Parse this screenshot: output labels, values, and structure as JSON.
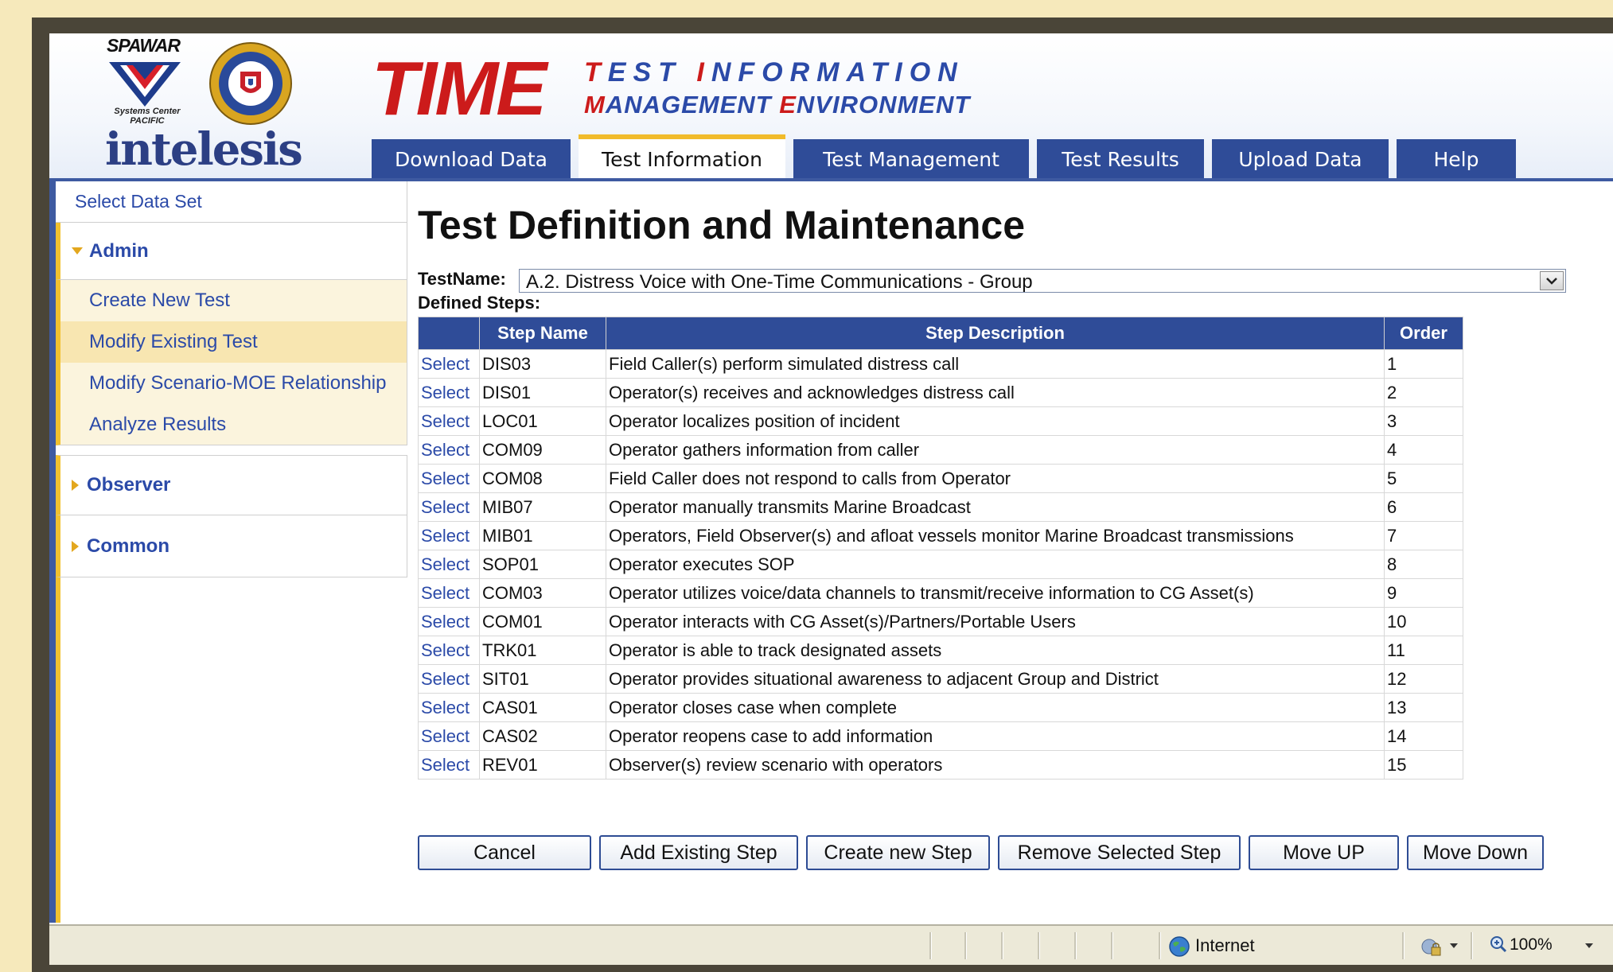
{
  "header": {
    "spawar": "SPAWAR",
    "systems_center": "Systems Center",
    "pacific": "PACIFIC",
    "intelesis": "intelesis",
    "time": "TIME",
    "subtitle_line1": {
      "cap1": "T",
      "rest1": "EST ",
      "cap2": "I",
      "rest2": "NFORMATION"
    },
    "subtitle_line2": {
      "cap1": "M",
      "rest1": "ANAGEMENT ",
      "cap2": "E",
      "rest2": "NVIRONMENT"
    },
    "accent_color": "#cc1b1b",
    "brand_blue": "#2b4aa8"
  },
  "tabs": [
    {
      "label": "Download Data"
    },
    {
      "label": "Test Information",
      "active": true
    },
    {
      "label": "Test Management"
    },
    {
      "label": "Test Results"
    },
    {
      "label": "Upload Data"
    },
    {
      "label": "Help"
    }
  ],
  "sidebar": {
    "select_data_set": "Select Data Set",
    "admin": {
      "label": "Admin",
      "items": [
        {
          "label": "Create New Test"
        },
        {
          "label": "Modify Existing Test",
          "selected": true
        },
        {
          "label": "Modify Scenario-MOE Relationship"
        },
        {
          "label": "Analyze Results"
        }
      ]
    },
    "observer": {
      "label": "Observer"
    },
    "common": {
      "label": "Common"
    }
  },
  "main": {
    "title": "Test Definition and Maintenance",
    "testname_label": "TestName:",
    "testname_value": "A.2. Distress Voice with One-Time Communications - Group",
    "defined_steps_label": "Defined Steps:",
    "table": {
      "headers": [
        "",
        "Step Name",
        "Step Description",
        "Order"
      ],
      "select_label": "Select",
      "rows": [
        {
          "name": "DIS03",
          "desc": "Field Caller(s) perform simulated distress call",
          "order": "1"
        },
        {
          "name": "DIS01",
          "desc": "Operator(s) receives and acknowledges distress call",
          "order": "2"
        },
        {
          "name": "LOC01",
          "desc": "Operator localizes position of incident",
          "order": "3"
        },
        {
          "name": "COM09",
          "desc": "Operator gathers information from caller",
          "order": "4"
        },
        {
          "name": "COM08",
          "desc": "Field Caller does not respond to calls from Operator",
          "order": "5"
        },
        {
          "name": "MIB07",
          "desc": "Operator manually transmits Marine Broadcast",
          "order": "6"
        },
        {
          "name": "MIB01",
          "desc": "Operators, Field Observer(s) and afloat vessels monitor Marine Broadcast transmissions",
          "order": "7"
        },
        {
          "name": "SOP01",
          "desc": "Operator executes SOP",
          "order": "8"
        },
        {
          "name": "COM03",
          "desc": "Operator utilizes voice/data channels to transmit/receive information to CG Asset(s)",
          "order": "9"
        },
        {
          "name": "COM01",
          "desc": "Operator interacts with CG Asset(s)/Partners/Portable Users",
          "order": "10"
        },
        {
          "name": "TRK01",
          "desc": "Operator is able to track designated assets",
          "order": "11"
        },
        {
          "name": "SIT01",
          "desc": "Operator provides situational awareness to adjacent Group and District",
          "order": "12"
        },
        {
          "name": "CAS01",
          "desc": "Operator closes case when complete",
          "order": "13"
        },
        {
          "name": "CAS02",
          "desc": "Operator reopens case to add information",
          "order": "14"
        },
        {
          "name": "REV01",
          "desc": "Observer(s) review scenario with operators",
          "order": "15"
        }
      ]
    },
    "buttons": {
      "cancel": "Cancel",
      "add_existing": "Add Existing Step",
      "create_new": "Create new Step",
      "remove_selected": "Remove Selected Step",
      "move_up": "Move UP",
      "move_down": "Move Down"
    }
  },
  "statusbar": {
    "zone": "Internet",
    "zoom": "100%"
  }
}
